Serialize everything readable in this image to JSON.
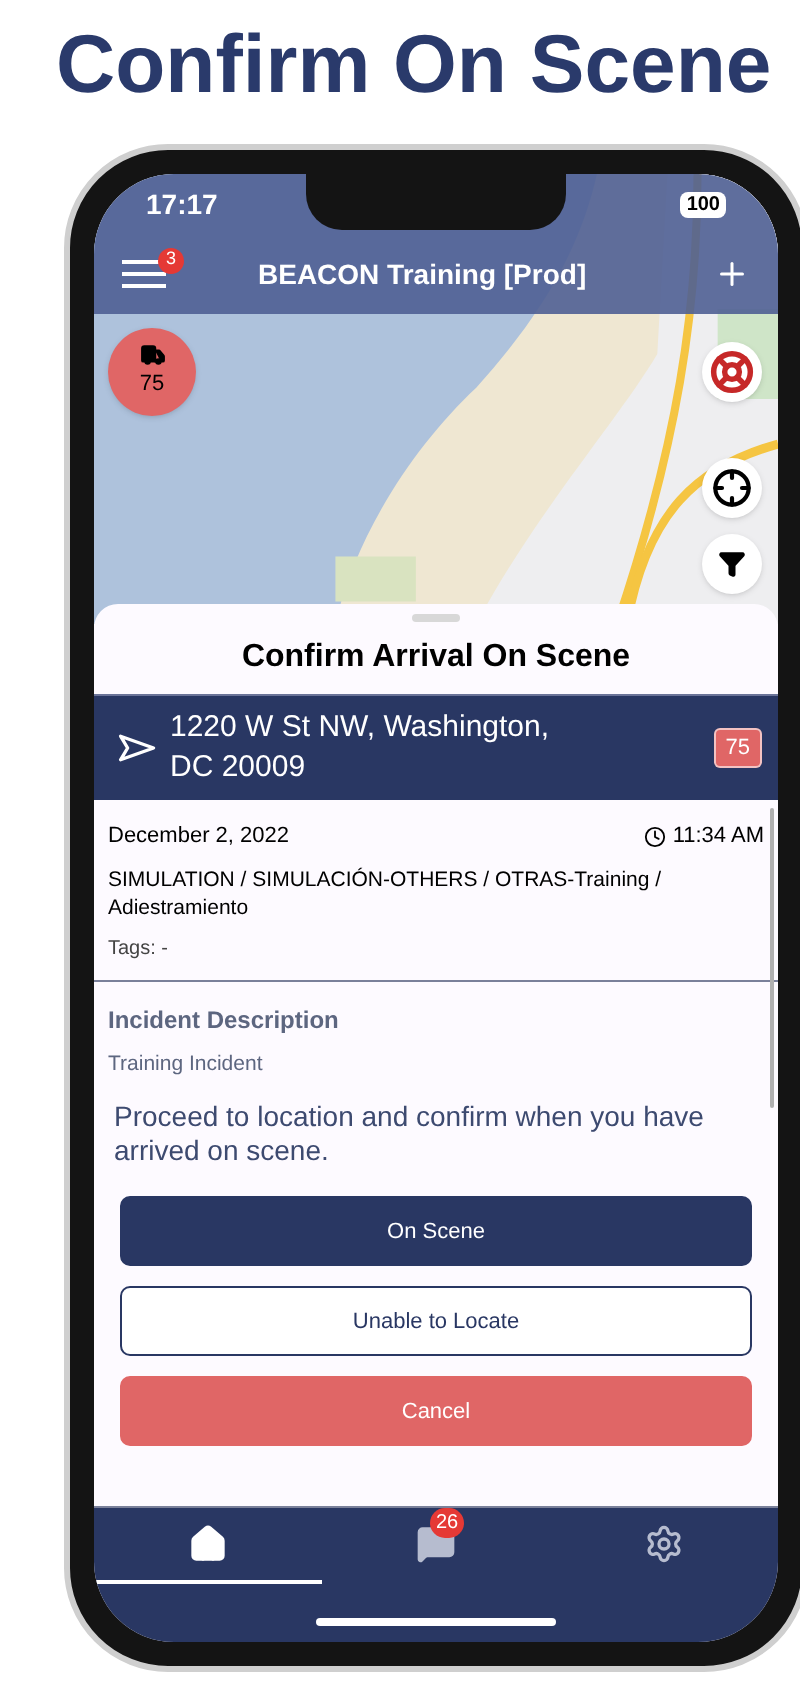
{
  "headline": "Confirm On Scene",
  "status_bar": {
    "time": "17:17",
    "battery": "100"
  },
  "header": {
    "menu_badge": "3",
    "title": "BEACON Training [Prod]"
  },
  "map": {
    "unit_badge": "75"
  },
  "sheet": {
    "title": "Confirm Arrival On Scene",
    "address": "1220 W St NW, Washington, DC 20009",
    "unit_tag": {
      "label": "75",
      "color": "#e06666"
    },
    "date": "December 2, 2022",
    "time": "11:34 AM",
    "type": "SIMULATION / SIMULACIÓN-OTHERS / OTRAS-Training / Adiestramiento",
    "tags": "Tags: -",
    "description_heading": "Incident Description",
    "description": "Training Incident",
    "prompt": "Proceed to location and confirm when you have arrived on scene.",
    "buttons": [
      {
        "label": "On Scene",
        "kind": "primary"
      },
      {
        "label": "Unable to Locate",
        "kind": "outline"
      },
      {
        "label": "Cancel",
        "kind": "danger"
      }
    ]
  },
  "nav": [
    {
      "kind": "home",
      "selected": true
    },
    {
      "kind": "messages",
      "selected": false,
      "badge": "26"
    },
    {
      "kind": "settings",
      "selected": false
    }
  ]
}
